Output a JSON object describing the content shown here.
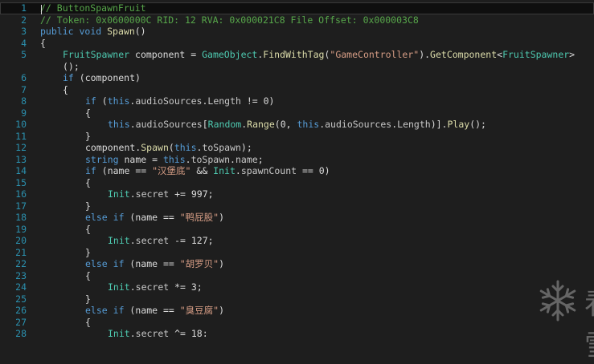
{
  "editor": {
    "lines": [
      {
        "n": "1",
        "indent": 0,
        "tokens": [
          [
            "// ButtonSpawnFruit",
            "c"
          ]
        ]
      },
      {
        "n": "2",
        "indent": 0,
        "tokens": [
          [
            "// Token: 0x0600000C RID: 12 RVA: 0x000021C8 File Offset: 0x000003C8",
            "c"
          ]
        ]
      },
      {
        "n": "3",
        "indent": 0,
        "tokens": [
          [
            "public",
            "k"
          ],
          [
            " ",
            "p"
          ],
          [
            "void",
            "k"
          ],
          [
            " ",
            "p"
          ],
          [
            "Spawn",
            "m"
          ],
          [
            "()",
            "p"
          ]
        ]
      },
      {
        "n": "4",
        "indent": 0,
        "tokens": [
          [
            "{",
            "p"
          ]
        ]
      },
      {
        "n": "5",
        "indent": 1,
        "tokens": [
          [
            "FruitSpawner",
            "t"
          ],
          [
            " component = ",
            "p"
          ],
          [
            "GameObject",
            "t"
          ],
          [
            ".",
            "p"
          ],
          [
            "FindWithTag",
            "m"
          ],
          [
            "(",
            "p"
          ],
          [
            "\"GameController\"",
            "s"
          ],
          [
            ").",
            "p"
          ],
          [
            "GetComponent",
            "m"
          ],
          [
            "<",
            "p"
          ],
          [
            "FruitSpawner",
            "t"
          ],
          [
            ">",
            "p"
          ]
        ]
      },
      {
        "n": "",
        "indent": 1,
        "tokens": [
          [
            "();",
            "p"
          ]
        ],
        "wrap": true
      },
      {
        "n": "6",
        "indent": 1,
        "tokens": [
          [
            "if",
            "k"
          ],
          [
            " (component)",
            "p"
          ]
        ]
      },
      {
        "n": "7",
        "indent": 1,
        "tokens": [
          [
            "{",
            "p"
          ]
        ]
      },
      {
        "n": "8",
        "indent": 2,
        "tokens": [
          [
            "if",
            "k"
          ],
          [
            " (",
            "p"
          ],
          [
            "this",
            "k"
          ],
          [
            ".",
            "p"
          ],
          [
            "audioSources",
            "f"
          ],
          [
            ".",
            "p"
          ],
          [
            "Length",
            "f"
          ],
          [
            " != 0)",
            "p"
          ]
        ]
      },
      {
        "n": "9",
        "indent": 2,
        "tokens": [
          [
            "{",
            "p"
          ]
        ]
      },
      {
        "n": "10",
        "indent": 3,
        "tokens": [
          [
            "this",
            "k"
          ],
          [
            ".",
            "p"
          ],
          [
            "audioSources",
            "f"
          ],
          [
            "[",
            "p"
          ],
          [
            "Random",
            "t"
          ],
          [
            ".",
            "p"
          ],
          [
            "Range",
            "m"
          ],
          [
            "(0, ",
            "p"
          ],
          [
            "this",
            "k"
          ],
          [
            ".",
            "p"
          ],
          [
            "audioSources",
            "f"
          ],
          [
            ".",
            "p"
          ],
          [
            "Length",
            "f"
          ],
          [
            ")].",
            "p"
          ],
          [
            "Play",
            "m"
          ],
          [
            "();",
            "p"
          ]
        ]
      },
      {
        "n": "11",
        "indent": 2,
        "tokens": [
          [
            "}",
            "p"
          ]
        ]
      },
      {
        "n": "12",
        "indent": 2,
        "tokens": [
          [
            "component.",
            "p"
          ],
          [
            "Spawn",
            "m"
          ],
          [
            "(",
            "p"
          ],
          [
            "this",
            "k"
          ],
          [
            ".",
            "p"
          ],
          [
            "toSpawn",
            "f"
          ],
          [
            ");",
            "p"
          ]
        ]
      },
      {
        "n": "13",
        "indent": 2,
        "tokens": [
          [
            "string",
            "k"
          ],
          [
            " name = ",
            "p"
          ],
          [
            "this",
            "k"
          ],
          [
            ".",
            "p"
          ],
          [
            "toSpawn",
            "f"
          ],
          [
            ".",
            "p"
          ],
          [
            "name",
            "f"
          ],
          [
            ";",
            "p"
          ]
        ]
      },
      {
        "n": "14",
        "indent": 2,
        "tokens": [
          [
            "if",
            "k"
          ],
          [
            " (name == ",
            "p"
          ],
          [
            "\"汉堡底\"",
            "s"
          ],
          [
            " && ",
            "p"
          ],
          [
            "Init",
            "t"
          ],
          [
            ".",
            "p"
          ],
          [
            "spawnCount",
            "f"
          ],
          [
            " == 0)",
            "p"
          ]
        ]
      },
      {
        "n": "15",
        "indent": 2,
        "tokens": [
          [
            "{",
            "p"
          ]
        ]
      },
      {
        "n": "16",
        "indent": 3,
        "tokens": [
          [
            "Init",
            "t"
          ],
          [
            ".",
            "p"
          ],
          [
            "secret",
            "f"
          ],
          [
            " += 997;",
            "p"
          ]
        ]
      },
      {
        "n": "17",
        "indent": 2,
        "tokens": [
          [
            "}",
            "p"
          ]
        ]
      },
      {
        "n": "18",
        "indent": 2,
        "tokens": [
          [
            "else",
            "k"
          ],
          [
            " ",
            "p"
          ],
          [
            "if",
            "k"
          ],
          [
            " (name == ",
            "p"
          ],
          [
            "\"鸭屁股\"",
            "s"
          ],
          [
            ")",
            "p"
          ]
        ]
      },
      {
        "n": "19",
        "indent": 2,
        "tokens": [
          [
            "{",
            "p"
          ]
        ]
      },
      {
        "n": "20",
        "indent": 3,
        "tokens": [
          [
            "Init",
            "t"
          ],
          [
            ".",
            "p"
          ],
          [
            "secret",
            "f"
          ],
          [
            " -= 127;",
            "p"
          ]
        ]
      },
      {
        "n": "21",
        "indent": 2,
        "tokens": [
          [
            "}",
            "p"
          ]
        ]
      },
      {
        "n": "22",
        "indent": 2,
        "tokens": [
          [
            "else",
            "k"
          ],
          [
            " ",
            "p"
          ],
          [
            "if",
            "k"
          ],
          [
            " (name == ",
            "p"
          ],
          [
            "\"胡罗贝\"",
            "s"
          ],
          [
            ")",
            "p"
          ]
        ]
      },
      {
        "n": "23",
        "indent": 2,
        "tokens": [
          [
            "{",
            "p"
          ]
        ]
      },
      {
        "n": "24",
        "indent": 3,
        "tokens": [
          [
            "Init",
            "t"
          ],
          [
            ".",
            "p"
          ],
          [
            "secret",
            "f"
          ],
          [
            " *= 3;",
            "p"
          ]
        ]
      },
      {
        "n": "25",
        "indent": 2,
        "tokens": [
          [
            "}",
            "p"
          ]
        ]
      },
      {
        "n": "26",
        "indent": 2,
        "tokens": [
          [
            "else",
            "k"
          ],
          [
            " ",
            "p"
          ],
          [
            "if",
            "k"
          ],
          [
            " (name == ",
            "p"
          ],
          [
            "\"臭豆腐\"",
            "s"
          ],
          [
            ")",
            "p"
          ]
        ]
      },
      {
        "n": "27",
        "indent": 2,
        "tokens": [
          [
            "{",
            "p"
          ]
        ]
      },
      {
        "n": "28",
        "indent": 3,
        "tokens": [
          [
            "Init",
            "t"
          ],
          [
            ".",
            "p"
          ],
          [
            "secret",
            "f"
          ],
          [
            " ^= 18;",
            "p"
          ]
        ]
      }
    ]
  },
  "watermark": {
    "text": "看雪",
    "icon": "snowflake-icon"
  },
  "colors": {
    "background": "#1e1e1e",
    "line_number": "#2b91af",
    "keyword": "#569cd6",
    "type": "#4ec9b0",
    "method": "#dcdcaa",
    "string": "#d69d85",
    "comment": "#57a64a",
    "field": "#c8c8c8",
    "plain": "#dcdcdc"
  }
}
